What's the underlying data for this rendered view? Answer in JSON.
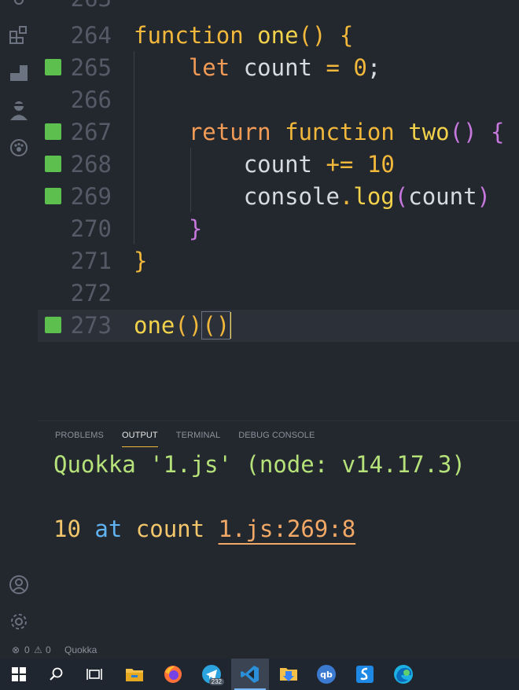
{
  "editor": {
    "lines": [
      {
        "num": "263",
        "partial": true
      },
      {
        "num": "264"
      },
      {
        "num": "265",
        "mark": true
      },
      {
        "num": "266"
      },
      {
        "num": "267",
        "mark": true
      },
      {
        "num": "268",
        "mark": true
      },
      {
        "num": "269",
        "mark": true
      },
      {
        "num": "270"
      },
      {
        "num": "271"
      },
      {
        "num": "272"
      },
      {
        "num": "273",
        "mark": true,
        "current": true
      }
    ],
    "tokens": {
      "l264_kw": "function",
      "l264_fn": "one",
      "l264_rest": "() {",
      "l265_kw": "let",
      "l265_var": "count",
      "l265_op": "=",
      "l265_num": "0",
      "l265_semi": ";",
      "l267_kw": "return",
      "l267_kw2": "function",
      "l267_fn": "two",
      "l267_par": "()",
      "l267_brace": "{",
      "l268_var": "count",
      "l268_op": "+=",
      "l268_num": "10",
      "l269_obj": "console",
      "l269_dot": ".",
      "l269_fn": "log",
      "l269_open": "(",
      "l269_arg": "count",
      "l269_close": ")",
      "l270_brace": "}",
      "l271_brace": "}",
      "l273_fn": "one",
      "l273_p1": "()",
      "l273_p2": "()"
    }
  },
  "panel": {
    "tabs": [
      "PROBLEMS",
      "OUTPUT",
      "TERMINAL",
      "DEBUG CONSOLE"
    ],
    "active_tab": "OUTPUT",
    "output_header": "Quokka '1.js' (node: v14.17.3)",
    "log_value": "10",
    "log_at": "at",
    "log_name": "count",
    "log_link": "1.js:269:8"
  },
  "status": {
    "errors": "0",
    "warnings": "0",
    "extension": "Quokka"
  },
  "taskbar": {
    "telegram_badge": "232",
    "apps": [
      "windows-start",
      "search",
      "task-view",
      "file-explorer",
      "firefox",
      "telegram",
      "vscode",
      "downloads-folder",
      "qbittorrent",
      "sandbox",
      "edge"
    ]
  },
  "colors": {
    "background": "#23272e",
    "keyword": "#f2b83b",
    "gutter_mark": "#5cbf4e",
    "output_header": "#b6e27a",
    "link": "#f2a866"
  }
}
